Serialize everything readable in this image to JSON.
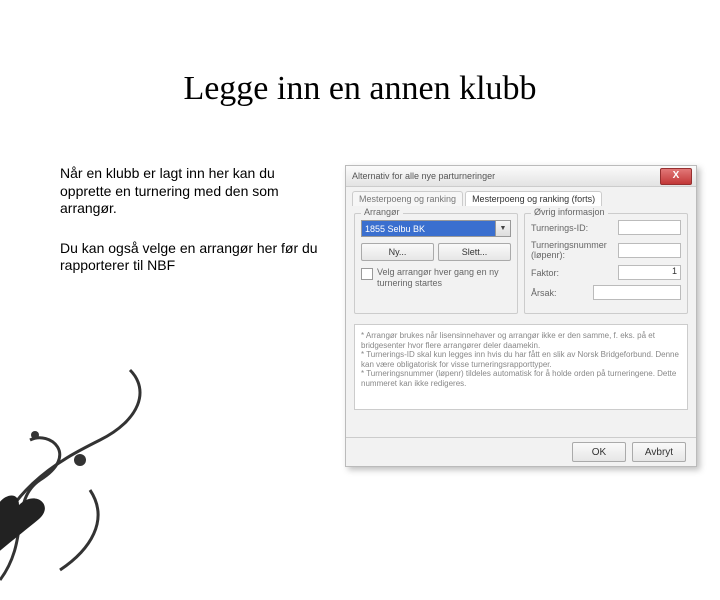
{
  "title": "Legge inn en annen klubb",
  "body": {
    "p1": "Når en klubb er lagt inn her kan du opprette en turnering med den som arrangør.",
    "p2": "Du kan også velge en arrangør her før du rapporterer til NBF"
  },
  "dialog": {
    "title": "Alternativ for alle nye parturneringer",
    "close": "X",
    "tabs": {
      "t1": "Mesterpoeng og ranking",
      "t2": "Mesterpoeng og ranking (forts)"
    },
    "arrangor": {
      "legend": "Arrangør",
      "selected": "1855 Selbu BK",
      "btn_new": "Ny...",
      "btn_del": "Slett...",
      "checkbox": "Velg arrangør hver gang en ny turnering startes"
    },
    "ovrig": {
      "legend": "Øvrig informasjon",
      "f1": "Turnerings-ID:",
      "f2": "Turneringsnummer (løpenr):",
      "f3": "Faktor:",
      "f3_val": "1",
      "f4": "Årsak:"
    },
    "notes": {
      "n1": "* Arrangør brukes når lisensinnehaver og arrangør ikke er den samme, f. eks. på et bridgesenter hvor flere arrangører deler daamekin.",
      "n2": "* Turnerings-ID skal kun legges inn hvis du har fått en slik av Norsk Bridgeforbund. Denne kan være obligatorisk for visse turneringsrapporttyper.",
      "n3": "* Turneringsnummer (løpenr) tildeles automatisk for å holde orden på turneringene. Dette nummeret kan ikke redigeres."
    },
    "buttons": {
      "ok": "OK",
      "cancel": "Avbryt"
    }
  }
}
